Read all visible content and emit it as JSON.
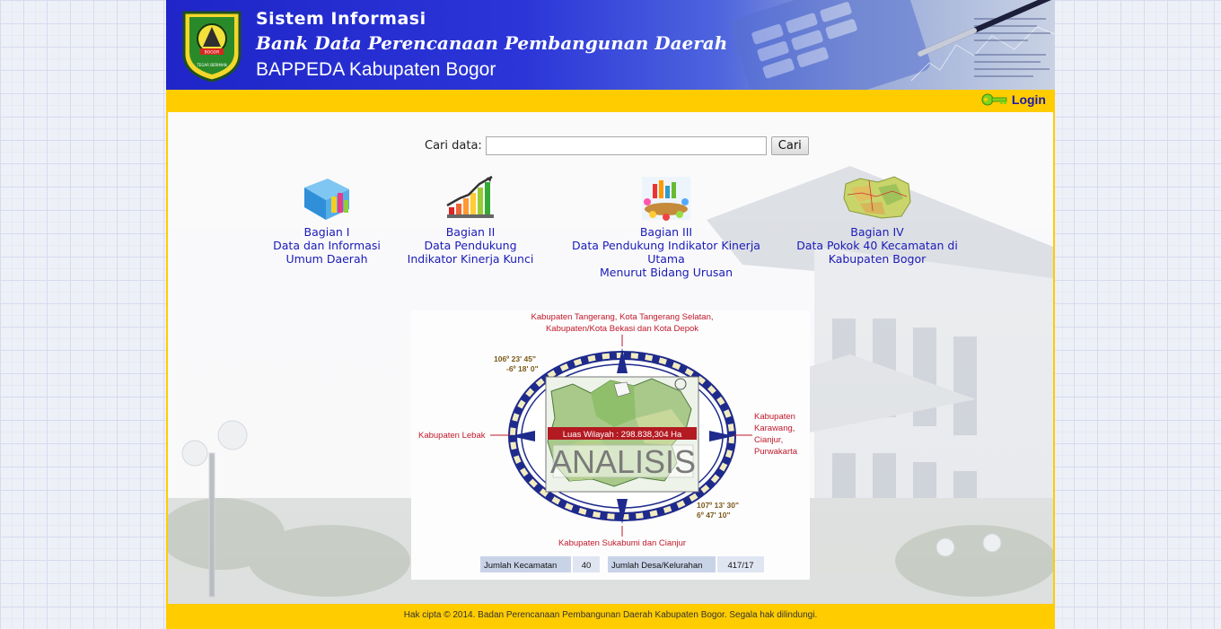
{
  "header": {
    "line1": "Sistem Informasi",
    "line2": "Bank Data Perencanaan Pembangunan Daerah",
    "line3": "BAPPEDA Kabupaten Bogor",
    "logo_motto": "TEGAR BERIMAN",
    "logo_name": "BOGOR"
  },
  "topbar": {
    "login_label": "Login"
  },
  "search": {
    "label": "Cari data:",
    "value": "",
    "button_label": "Cari"
  },
  "menu": [
    {
      "icon": "folder-chart-icon",
      "title": "Bagian I",
      "line1": "Data dan Informasi",
      "line2": "Umum Daerah"
    },
    {
      "icon": "growth-chart-icon",
      "title": "Bagian II",
      "line1": "Data Pendukung",
      "line2": "Indikator Kinerja Kunci"
    },
    {
      "icon": "meeting-chart-icon",
      "title": "Bagian III",
      "line1": "Data Pendukung Indikator Kinerja Utama",
      "line2": "Menurut Bidang Urusan"
    },
    {
      "icon": "district-map-icon",
      "title": "Bagian IV",
      "line1": "Data Pokok 40 Kecamatan di",
      "line2": "Kabupaten Bogor"
    }
  ],
  "map": {
    "north_line1": "Kabupaten  Tangerang, Kota Tangerang Selatan,",
    "north_line2": "Kabupaten/Kota Bekasi dan Kota Depok",
    "west": "Kabupaten Lebak",
    "east_line1": "Kabupaten",
    "east_line2": "Karawang,",
    "east_line3": "Cianjur,",
    "east_line4": "Purwakarta",
    "south": "Kabupaten Sukabumi dan Cianjur",
    "coord_nw_1": "106º 23' 45\"",
    "coord_nw_2": "-6º 18' 0\"",
    "coord_se_1": "107º 13' 30\"",
    "coord_se_2": "6º 47' 10\"",
    "area_text": "Luas Wilayah : 298.838,304 Ha",
    "watermark": "ANALISIS",
    "stat1_label": "Jumlah Kecamatan",
    "stat1_value": "40",
    "stat2_label": "Jumlah Desa/Kelurahan",
    "stat2_value": "417/17"
  },
  "footer": {
    "text": "Hak cipta © 2014. Badan Perencanaan Pembangunan Daerah Kabupaten Bogor. Segala hak dilindungi."
  },
  "colors": {
    "header_blue": "#1f25c8",
    "accent_yellow": "#ffcc00",
    "link_blue": "#1a1ab8",
    "map_red": "#c0182a"
  }
}
